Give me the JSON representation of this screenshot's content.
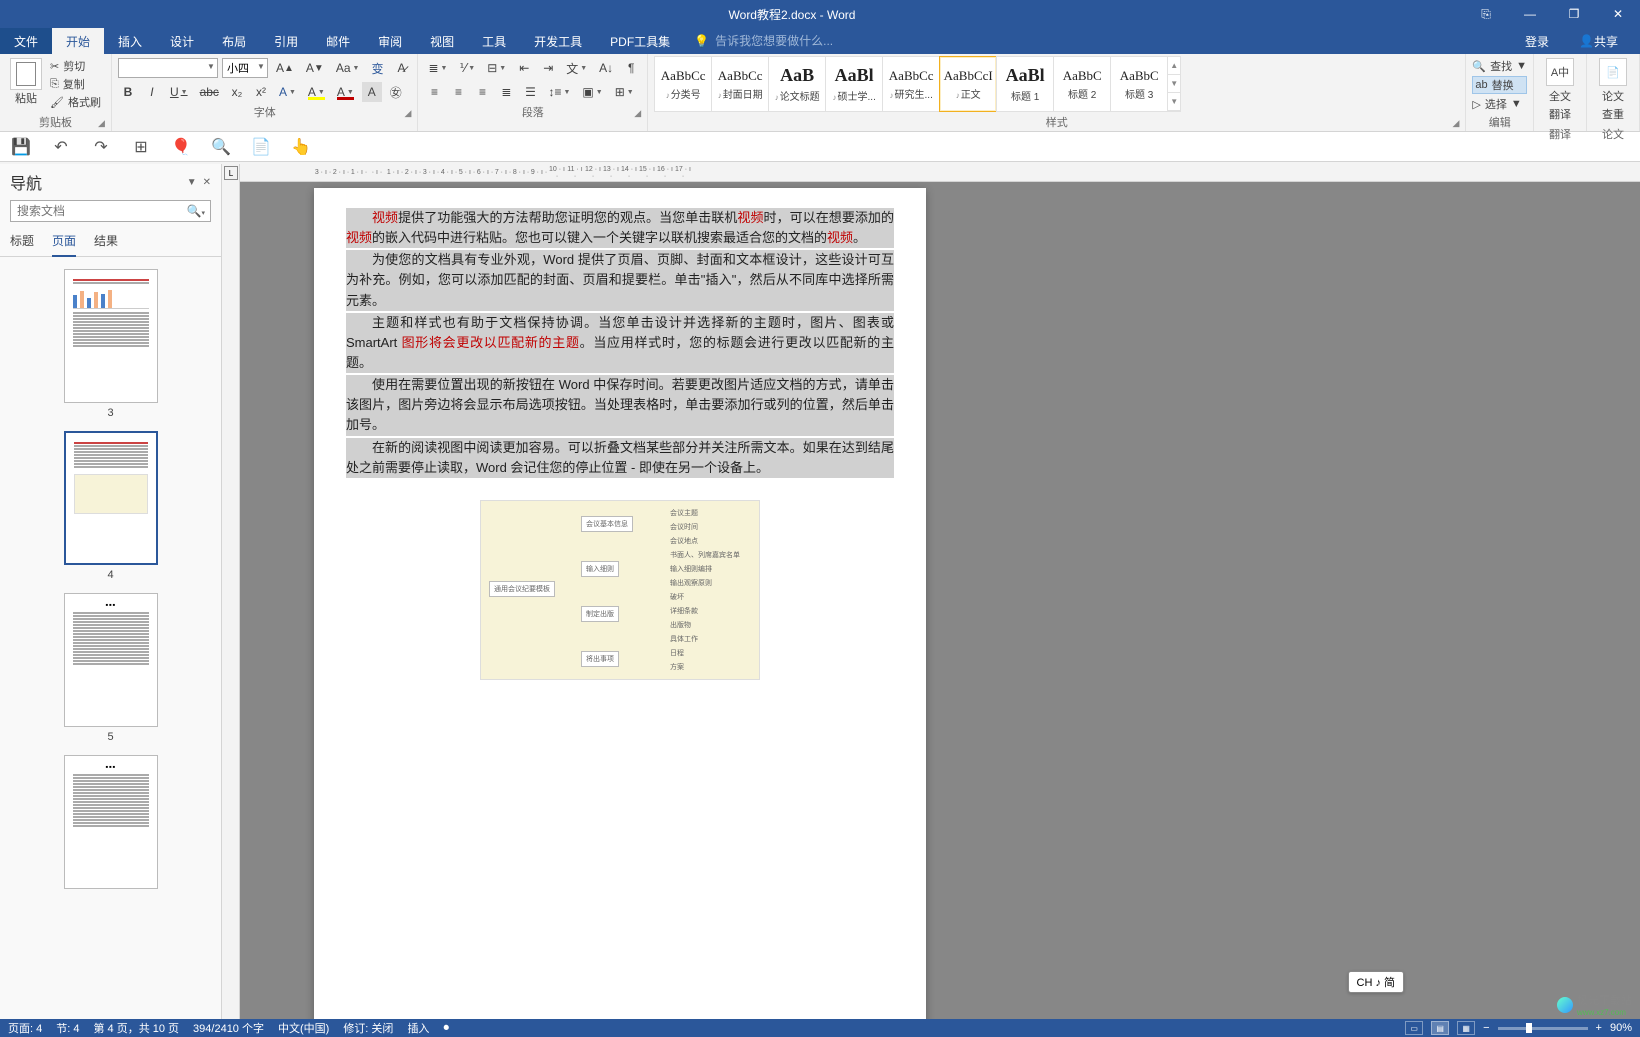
{
  "title_bar": {
    "doc_title": "Word教程2.docx - Word"
  },
  "window_controls": {
    "ribbon_opts": "⎘",
    "min": "—",
    "max": "❐",
    "close": "✕"
  },
  "ribbon_tabs": {
    "file": "文件",
    "home": "开始",
    "insert": "插入",
    "design": "设计",
    "layout": "布局",
    "references": "引用",
    "mailings": "邮件",
    "review": "审阅",
    "view": "视图",
    "tools": "工具",
    "developer": "开发工具",
    "pdf": "PDF工具集",
    "tell_me_placeholder": "告诉我您想要做什么...",
    "login": "登录",
    "share": "共享"
  },
  "ribbon": {
    "clipboard": {
      "paste": "粘贴",
      "cut": "剪切",
      "copy": "复制",
      "format_painter": "格式刷",
      "label": "剪贴板"
    },
    "font": {
      "name": "",
      "size": "小四",
      "bold": "B",
      "italic": "I",
      "underline": "U",
      "strike": "abc",
      "sub": "x₂",
      "sup": "x²",
      "label": "字体"
    },
    "para": {
      "label": "段落"
    },
    "styles": {
      "label": "样式",
      "items": [
        {
          "prev": "AaBbCc",
          "name": "分类号",
          "mus": true
        },
        {
          "prev": "AaBbCc",
          "name": "封面日期",
          "mus": true
        },
        {
          "prev": "AaB",
          "name": "论文标题",
          "mus": true,
          "big": true
        },
        {
          "prev": "AaBl",
          "name": "硕士学...",
          "mus": true,
          "big": true
        },
        {
          "prev": "AaBbCc",
          "name": "研究生...",
          "mus": true
        },
        {
          "prev": "AaBbCcI",
          "name": "正文",
          "sel": true,
          "mus": true
        },
        {
          "prev": "AaBl",
          "name": "标题 1",
          "big": true
        },
        {
          "prev": "AaBbC",
          "name": "标题 2"
        },
        {
          "prev": "AaBbC",
          "name": "标题 3"
        }
      ]
    },
    "editing": {
      "find": "查找",
      "replace": "替换",
      "select": "选择",
      "label": "编辑"
    },
    "translate_full": {
      "l1": "全文",
      "l2": "翻译",
      "label": "翻译"
    },
    "check": {
      "l1": "论文",
      "l2": "查重",
      "label": "论文"
    }
  },
  "qat": [
    "save",
    "undo",
    "redo",
    "table",
    "balloon",
    "search",
    "page",
    "touch"
  ],
  "nav": {
    "title": "导航",
    "search_placeholder": "搜索文档",
    "tabs": {
      "headings": "标题",
      "pages": "页面",
      "results": "结果"
    },
    "thumbs": [
      {
        "num": "3",
        "sel": false,
        "type": "chart"
      },
      {
        "num": "4",
        "sel": true,
        "type": "diagram"
      },
      {
        "num": "5",
        "sel": false,
        "type": "text"
      },
      {
        "num": "",
        "sel": false,
        "type": "text"
      }
    ]
  },
  "hruler_ticks": [
    "3",
    "2",
    "1",
    "",
    "1",
    "2",
    "3",
    "4",
    "5",
    "6",
    "7",
    "8",
    "9",
    "10",
    "11",
    "12",
    "13",
    "14",
    "15",
    "16",
    "17"
  ],
  "document": {
    "paragraphs": [
      {
        "sel": true,
        "segments": [
          {
            "red": true,
            "text": "视频"
          },
          {
            "text": "提供了功能强大的方法帮助您证明您的观点。当您单击联机"
          },
          {
            "red": true,
            "text": "视频"
          },
          {
            "text": "时，可以在想要添加的"
          },
          {
            "red": true,
            "text": "视频"
          },
          {
            "text": "的嵌入代码中进行粘贴。您也可以键入一个关键字以联机搜索最适合您的文档的"
          },
          {
            "red": true,
            "text": "视频"
          },
          {
            "text": "。"
          }
        ]
      },
      {
        "sel": true,
        "segments": [
          {
            "text": "为使您的文档具有专业外观，Word 提供了页眉、页脚、封面和文本框设计，这些设计可互为补充。例如，您可以添加匹配的封面、页眉和提要栏。单击\"插入\"，然后从不同库中选择所需元素。"
          }
        ]
      },
      {
        "sel": true,
        "segments": [
          {
            "text": "主题和样式也有助于文档保持协调。当您单击设计并选择新的主题时，图片、图表或 SmartArt "
          },
          {
            "red": true,
            "text": "图形将会更改以匹配新的主题"
          },
          {
            "text": "。当应用样式时，您的标题会进行更改以匹配新的主题。"
          }
        ]
      },
      {
        "sel": true,
        "segments": [
          {
            "text": "使用在需要位置出现的新按钮在 Word 中保存时间。若要更改图片适应文档的方式，请单击该图片，图片旁边将会显示布局选项按钮。当处理表格时，单击要添加行或列的位置，然后单击加号。"
          }
        ]
      },
      {
        "sel": true,
        "segments": [
          {
            "text": "在新的阅读视图中阅读更加容易。可以折叠文档某些部分并关注所需文本。如果在达到结尾处之前需要停止读取，Word 会记住您的停止位置 - 即使在另一个设备上。"
          }
        ]
      }
    ],
    "diagram": {
      "root": "通用会议纪要模板",
      "nodes": [
        "会议基本信息",
        "输入细则",
        "制定出版",
        "将出事项"
      ],
      "leaves": [
        "会议主题",
        "会议时间",
        "会议地点",
        "书面人、列席嘉宾名单",
        "输入细则编排",
        "输出观察原则",
        "破坏",
        "详细条款",
        "出版物",
        "具体工作",
        "日程",
        "方案"
      ]
    }
  },
  "ime": "CH ♪ 简",
  "watermark": "极光下载站",
  "watermark_url": "www.xz7.com",
  "status": {
    "page": "页面: 4",
    "section": "节: 4",
    "page_of": "第 4 页，共 10 页",
    "words": "394/2410 个字",
    "lang": "中文(中国)",
    "track": "修订: 关闭",
    "insert": "插入",
    "zoom": "90%"
  }
}
